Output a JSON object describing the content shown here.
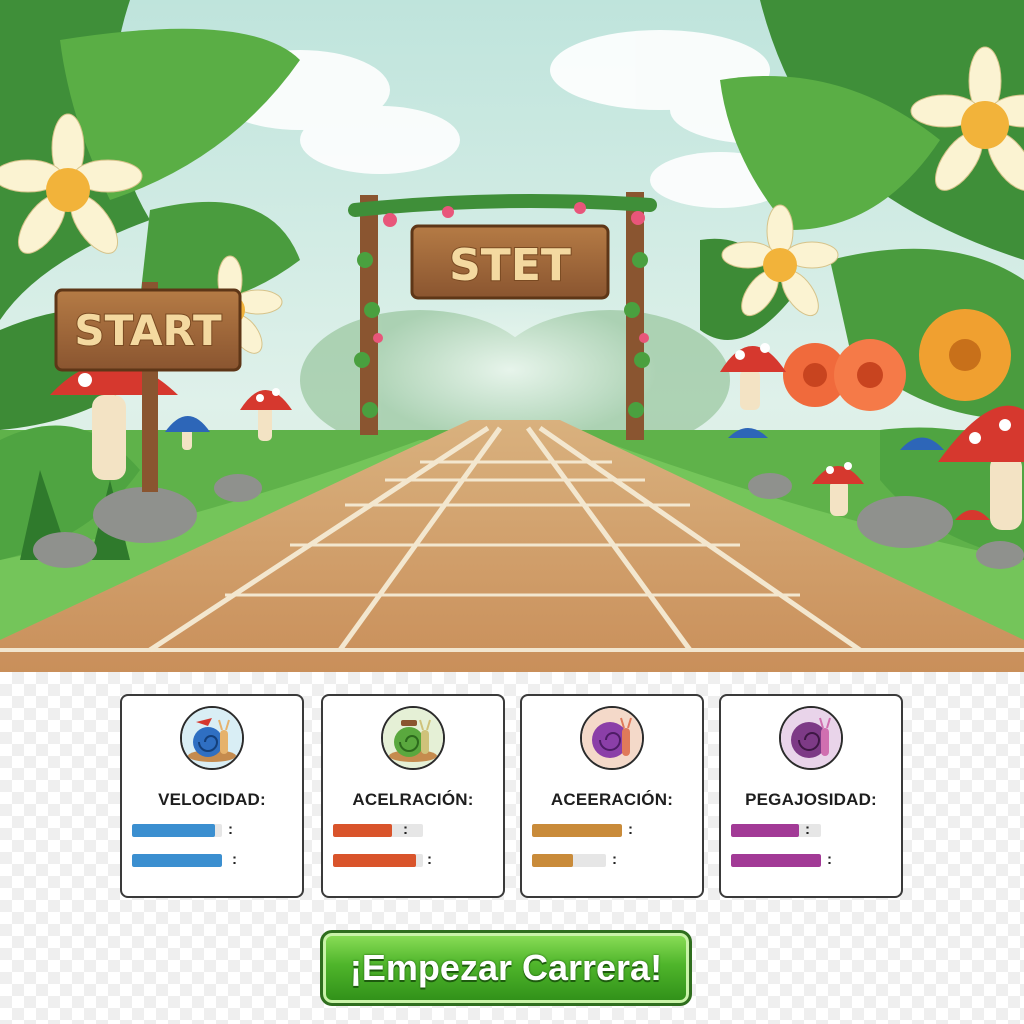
{
  "scene": {
    "left_sign_text": "START",
    "arch_sign_text": "STET"
  },
  "stats": [
    {
      "label": "VELOCIDAD:",
      "color": "#3b8fd0",
      "bars": [
        {
          "fill": 0.92,
          "suffix": ":"
        },
        {
          "fill": 1.0,
          "suffix": ":"
        }
      ]
    },
    {
      "label": "ACELRACIÓN:",
      "color": "#d9542b",
      "bars": [
        {
          "fill": 0.65,
          "suffix": ":"
        },
        {
          "fill": 0.92,
          "suffix": ":"
        }
      ]
    },
    {
      "label": "ACEERACIÓN:",
      "color": "#c98b3a",
      "bars": [
        {
          "fill": 1.0,
          "suffix": ":"
        },
        {
          "fill": 0.55,
          "suffix": ":"
        }
      ]
    },
    {
      "label": "PEGAJOSIDAD:",
      "color": "#a23a96",
      "bars": [
        {
          "fill": 0.75,
          "suffix": ":"
        },
        {
          "fill": 1.0,
          "suffix": ":"
        }
      ]
    }
  ],
  "start_button": {
    "label": "¡Empezar Carrera!",
    "color": "#4fb52b"
  }
}
